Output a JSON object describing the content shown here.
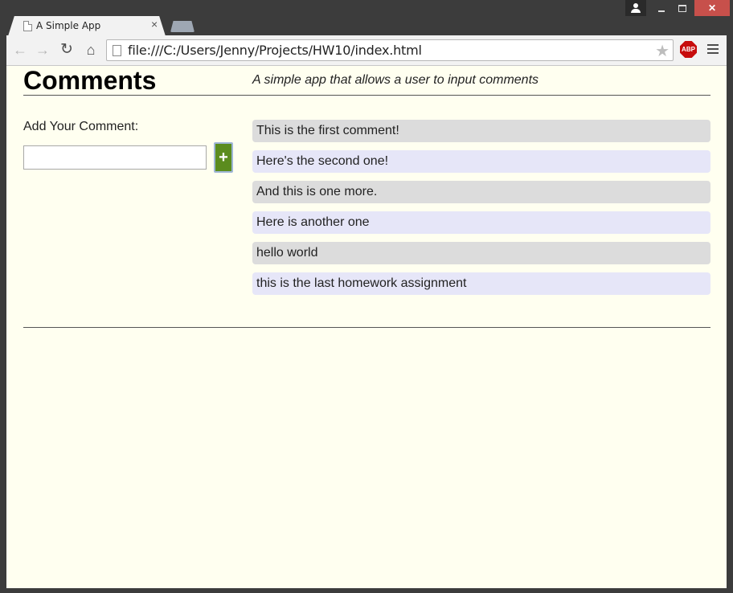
{
  "browser": {
    "tab_title": "A Simple App",
    "tab_close": "×",
    "url": "file:///C:/Users/Jenny/Projects/HW10/index.html",
    "abp_label": "ABP",
    "icons": [
      "back-icon",
      "forward-icon",
      "reload-icon",
      "home-icon",
      "page-icon",
      "star-icon",
      "adblock-icon",
      "menu-icon",
      "user-icon",
      "minimize-icon",
      "maximize-icon",
      "close-icon"
    ],
    "nav": {
      "back": "←",
      "forward": "→",
      "reload": "↻",
      "home": "⌂",
      "star": "★",
      "close": "✕"
    }
  },
  "page": {
    "title": "Comments",
    "subtitle": "A simple app that allows a user to input comments",
    "add_label": "Add Your Comment:",
    "input_value": "",
    "add_button_label": "+",
    "comments": [
      "This is the first comment!",
      "Here's the second one!",
      "And this is one more.",
      "Here is another one",
      "hello world",
      "this is the last homework assignment"
    ]
  },
  "colors": {
    "page_background": "#fffff0",
    "comment_odd": "#dcdcdc",
    "comment_even": "#e6e6f8",
    "add_button": "#5b8c1e"
  }
}
